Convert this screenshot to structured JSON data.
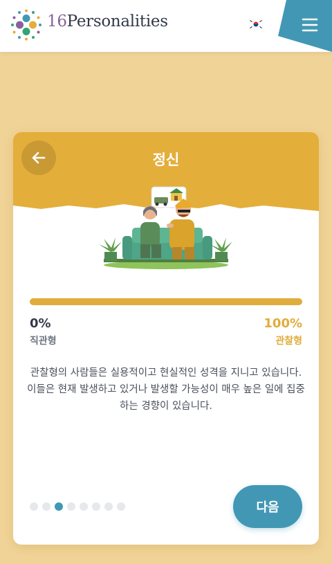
{
  "header": {
    "brand_number": "16",
    "brand_name": "Personalities",
    "flag_icon": "korea-flag-icon",
    "menu_icon": "hamburger-menu-icon",
    "accent_color": "#4298b4"
  },
  "card": {
    "title": "정신",
    "back_icon": "arrow-left-icon",
    "accent_color": "#e0ac3b",
    "progress": {
      "value_percent": 100,
      "left_percent": "0%",
      "left_label": "직관형",
      "right_percent": "100%",
      "right_label": "관찰형"
    },
    "description": "관찰형의 사람들은 실용적이고 현실적인 성격을 지니고 있습니다. 이들은 현재 발생하고 있거나 발생할 가능성이 매우 높은 일에 집중하는 경향이 있습니다.",
    "pagination": {
      "total": 8,
      "active_index": 2
    },
    "next_label": "다음"
  }
}
